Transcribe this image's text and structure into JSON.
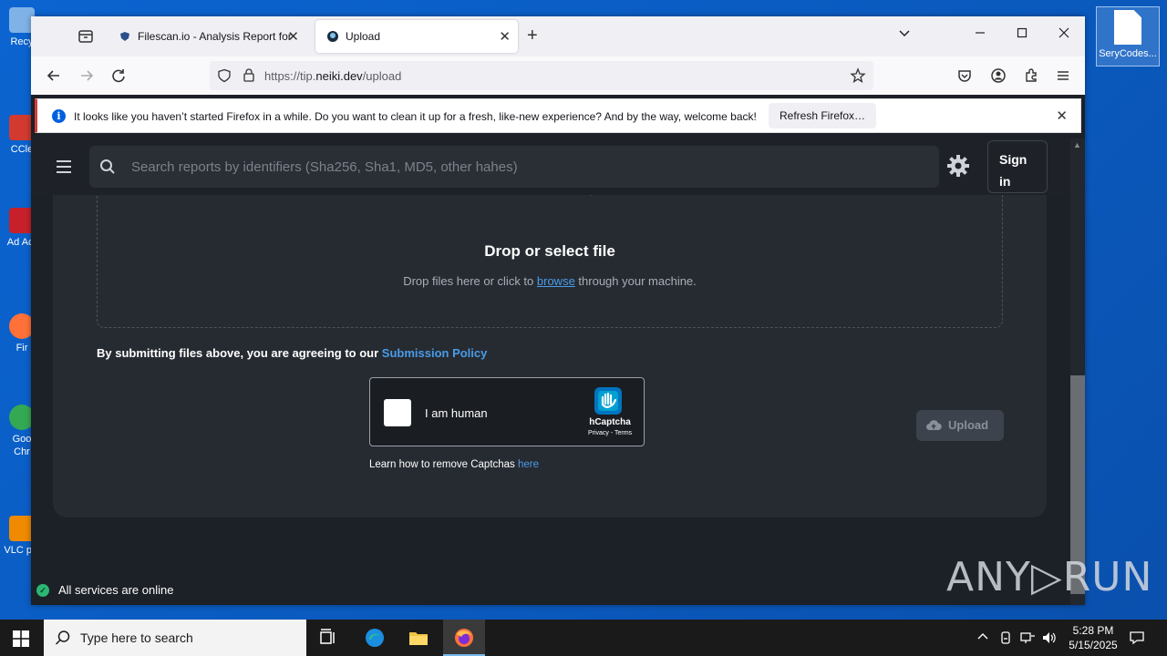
{
  "desktop": {
    "icons": [
      {
        "label": "Recy",
        "color": "#7fb2e6"
      },
      {
        "label": "CCle",
        "color": "#d23a2f"
      },
      {
        "label": "Ad Acr",
        "color": "#c8202a"
      },
      {
        "label": "Fir",
        "color": "#ff7139"
      },
      {
        "label": "Goo Chr",
        "color": "#34a853"
      },
      {
        "label": "VLC pla",
        "color": "#f08a00"
      }
    ],
    "right_file": "SeryCodes..."
  },
  "browser": {
    "tabs": [
      {
        "title": "Filescan.io - Analysis Report for",
        "close": "✕"
      },
      {
        "title": "Upload",
        "close": "✕"
      }
    ],
    "new_tab": "+",
    "url_prefix": "https://tip.",
    "url_domain": "neiki.dev",
    "url_path": "/upload",
    "notification": {
      "message": "It looks like you haven’t started Firefox in a while. Do you want to clean it up for a fresh, like-new experience? And by the way, welcome back!",
      "button": "Refresh Firefox…",
      "info_glyph": "i"
    }
  },
  "site": {
    "search_placeholder": "Search reports by identifiers (Sha256, Sha1, MD5, other hahes)",
    "sign_in": "Sign in",
    "drop_title": "Drop or select file",
    "drop_sub_before": "Drop files here or click to ",
    "drop_sub_link": "browse",
    "drop_sub_after": " through your machine.",
    "policy_text": "By submitting files above, you are agreeing to our ",
    "policy_link": "Submission Policy",
    "captcha": {
      "label": "I am human",
      "brand": "hCaptcha",
      "links": "Privacy - Terms"
    },
    "learn_text": "Learn how to remove Captchas ",
    "learn_link": "here",
    "upload_button": "Upload",
    "status": "All services are online"
  },
  "taskbar": {
    "search_placeholder": "Type here to search",
    "time": "5:28 PM",
    "date": "5/15/2025"
  },
  "watermark": "ANY▷RUN",
  "colors": {
    "accent_link": "#4a9be8",
    "status_green": "#2bb673",
    "notif_border": "#d63b3b"
  }
}
